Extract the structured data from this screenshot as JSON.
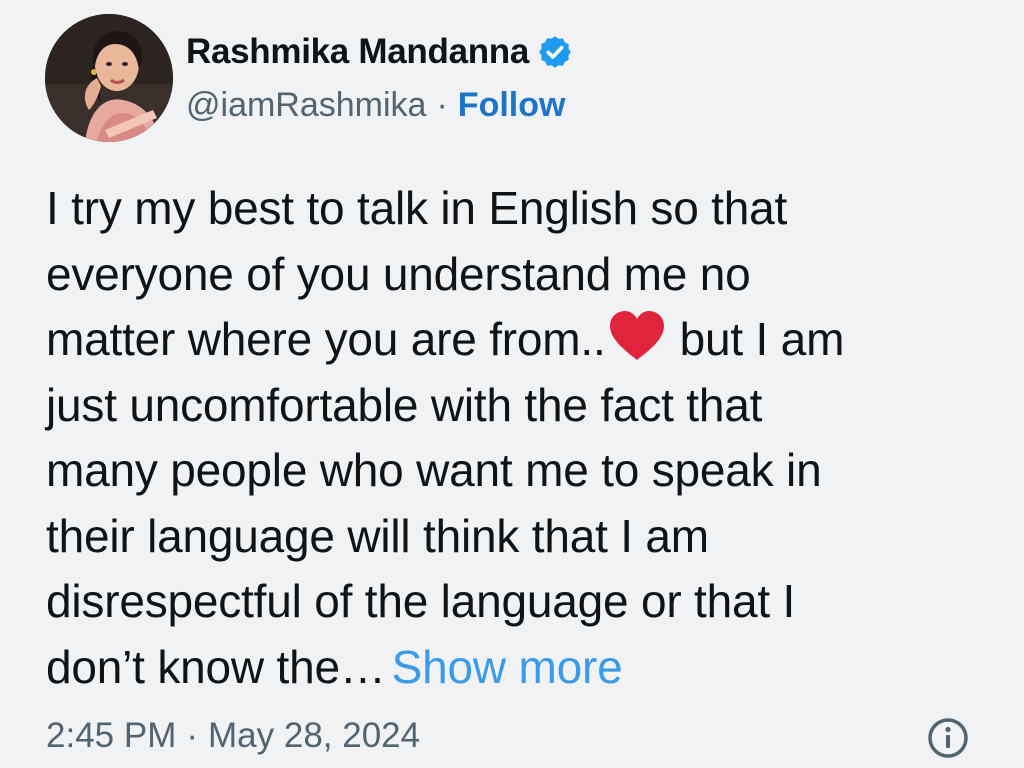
{
  "author": {
    "display_name": "Rashmika Mandanna",
    "handle": "@iamRashmika",
    "separator": "·",
    "follow_label": "Follow",
    "verified_icon": "verified-badge-icon",
    "colors": {
      "verified": "#1d9bf0",
      "follow": "#1d74c9"
    }
  },
  "tweet": {
    "lines": [
      "I try my best to talk in English so that",
      "everyone of you understand me no",
      "matter where you are from..",
      "but I am",
      "just uncomfortable with the fact that",
      "many people who want me to speak in",
      "their language will think that I am",
      "disrespectful of the language or that I",
      "don’t know the…"
    ],
    "emoji": "heart-icon",
    "show_more_label": "Show more",
    "colors": {
      "text": "#0f1419",
      "show_more": "#3c9be6",
      "heart": "#e0243b"
    }
  },
  "meta": {
    "time": "2:45 PM",
    "separator": "·",
    "date": "May 28, 2024",
    "info_icon": "info-icon"
  }
}
